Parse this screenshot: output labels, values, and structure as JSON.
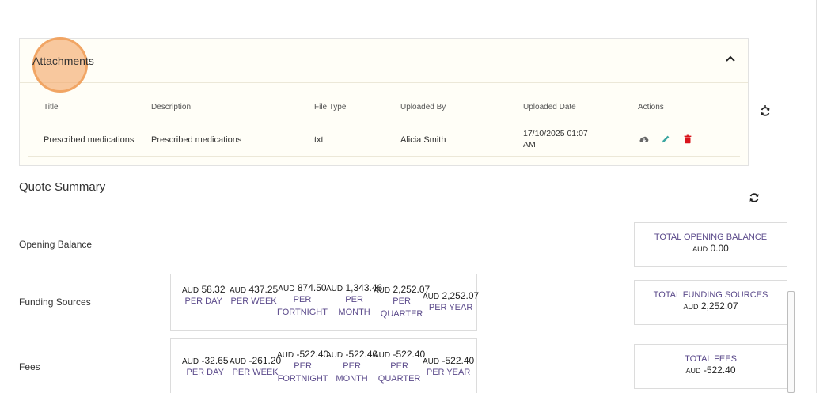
{
  "attachments": {
    "title": "Attachments",
    "columns": [
      "Title",
      "Description",
      "File Type",
      "Uploaded By",
      "Uploaded Date",
      "Actions"
    ],
    "rows": [
      {
        "title": "Prescribed medications",
        "description": "Prescribed medications",
        "file_type": "txt",
        "uploaded_by": "Alicia Smith",
        "uploaded_date_line1": "17/10/2025 01:07",
        "uploaded_date_line2": "AM"
      }
    ],
    "icons": {
      "collapse": "chevron-up-icon",
      "download": "cloud-download-icon",
      "edit": "pencil-icon",
      "delete": "trash-icon"
    },
    "icon_colors": {
      "download": "#666666",
      "edit": "#3aa6a0",
      "delete": "#d9141c"
    }
  },
  "quote_summary": {
    "title": "Quote Summary",
    "opening_balance": {
      "label": "Opening Balance",
      "total_label": "TOTAL OPENING BALANCE",
      "total_currency": "AUD",
      "total_value": "0.00"
    },
    "funding_sources": {
      "label": "Funding Sources",
      "rates": [
        {
          "currency": "AUD",
          "amount": "58.32",
          "per1": "PER DAY",
          "per2": ""
        },
        {
          "currency": "AUD",
          "amount": "437.25",
          "per1": "PER WEEK",
          "per2": ""
        },
        {
          "currency": "AUD",
          "amount": "874.50",
          "per1": "PER",
          "per2": "FORTNIGHT"
        },
        {
          "currency": "AUD",
          "amount": "1,343.46",
          "per1": "PER",
          "per2": "MONTH"
        },
        {
          "currency": "AUD",
          "amount": "2,252.07",
          "per1": "PER",
          "per2": "QUARTER"
        },
        {
          "currency": "AUD",
          "amount": "2,252.07",
          "per1": "PER YEAR",
          "per2": ""
        }
      ],
      "total_label": "TOTAL FUNDING SOURCES",
      "total_currency": "AUD",
      "total_value": "2,252.07"
    },
    "fees": {
      "label": "Fees",
      "rates": [
        {
          "currency": "AUD",
          "amount": "-32.65",
          "per1": "PER DAY",
          "per2": ""
        },
        {
          "currency": "AUD",
          "amount": "-261.20",
          "per1": "PER WEEK",
          "per2": ""
        },
        {
          "currency": "AUD",
          "amount": "-522.40",
          "per1": "PER",
          "per2": "FORTNIGHT"
        },
        {
          "currency": "AUD",
          "amount": "-522.40",
          "per1": "PER",
          "per2": "MONTH"
        },
        {
          "currency": "AUD",
          "amount": "-522.40",
          "per1": "PER",
          "per2": "QUARTER"
        },
        {
          "currency": "AUD",
          "amount": "-522.40",
          "per1": "PER YEAR",
          "per2": ""
        }
      ],
      "total_label": "TOTAL FEES",
      "total_currency": "AUD",
      "total_value": "-522.40"
    },
    "icons": {
      "refresh": "refresh-icon"
    }
  },
  "colors": {
    "accent_label": "#5b4a8b",
    "highlight": "#f5aa6e"
  }
}
